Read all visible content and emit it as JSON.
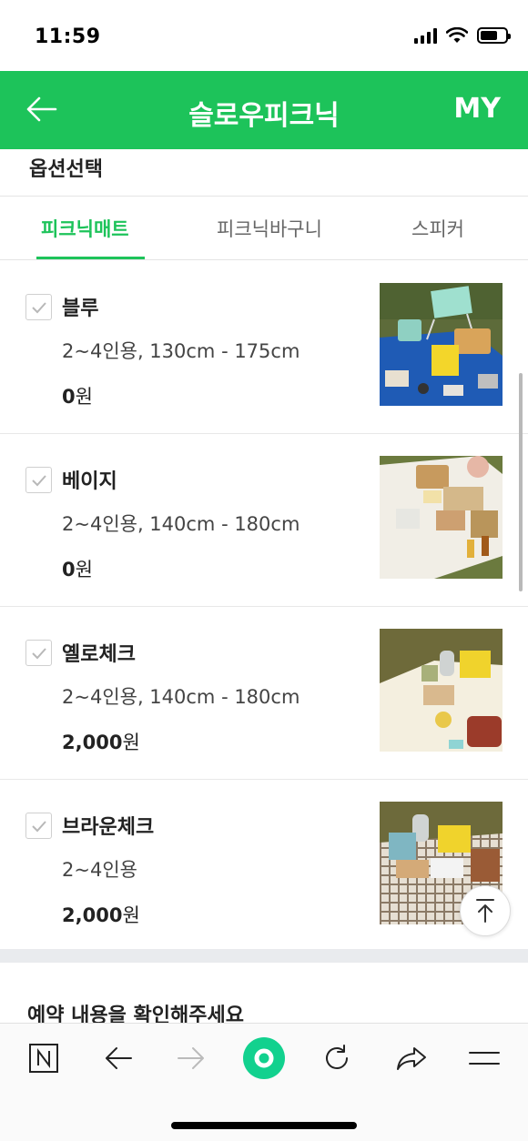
{
  "status_bar": {
    "time": "11:59"
  },
  "header": {
    "title": "슬로우피크닉",
    "my_label": "MY"
  },
  "section": {
    "title": "옵션선택"
  },
  "tabs": [
    {
      "label": "피크닉매트",
      "active": true
    },
    {
      "label": "피크닉바구니",
      "active": false
    },
    {
      "label": "스피커",
      "active": false
    }
  ],
  "options": [
    {
      "name": "블루",
      "size": "2~4인용, 130cm - 175cm",
      "price_amount": "0",
      "price_unit": "원"
    },
    {
      "name": "베이지",
      "size": "2~4인용, 140cm - 180cm",
      "price_amount": "0",
      "price_unit": "원"
    },
    {
      "name": "옐로체크",
      "size": "2~4인용, 140cm - 180cm",
      "price_amount": "2,000",
      "price_unit": "원"
    },
    {
      "name": "브라운체크",
      "size": "2~4인용",
      "price_amount": "2,000",
      "price_unit": "원"
    }
  ],
  "confirm": {
    "title": "예약 내용을 확인해주세요"
  },
  "browser_bar": {
    "items": [
      "naver-n-icon",
      "back-arrow-icon",
      "forward-arrow-icon",
      "green-home-icon",
      "refresh-icon",
      "share-icon",
      "menu-icon"
    ]
  },
  "colors": {
    "brand_green": "#1dc35a",
    "gray_band": "#e9ebee"
  }
}
